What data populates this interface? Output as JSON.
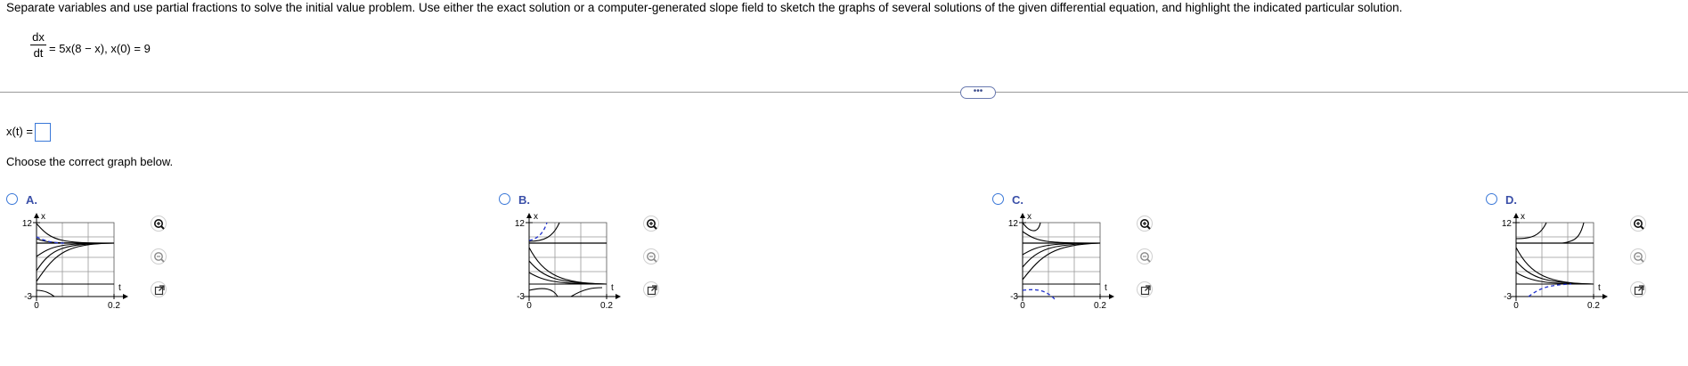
{
  "prompt": "Separate variables and use partial fractions to solve the initial value problem. Use either the exact solution or a computer-generated slope field to sketch the graphs of several solutions of the given differential equation, and highlight the indicated particular solution.",
  "equation": {
    "numerator": "dx",
    "denominator": "dt",
    "rest": "= 5x(8 − x), x(0) = 9"
  },
  "more_label": "•••",
  "answer": {
    "label": "x(t) =",
    "value": ""
  },
  "choose_text": "Choose the correct graph below.",
  "axis": {
    "x_label": "t",
    "y_label": "x",
    "y_max_tick": "12",
    "y_min_tick": "-3",
    "x_min_tick": "0",
    "x_max_tick": "0.2"
  },
  "options": [
    {
      "id": "a",
      "label": "A.",
      "variant": "A"
    },
    {
      "id": "b",
      "label": "B.",
      "variant": "B"
    },
    {
      "id": "c",
      "label": "C.",
      "variant": "C"
    },
    {
      "id": "d",
      "label": "D.",
      "variant": "D"
    }
  ],
  "colors": {
    "highlight": "#2233cc",
    "radio": "#3a78d8",
    "option_label": "#3a4fa8"
  }
}
